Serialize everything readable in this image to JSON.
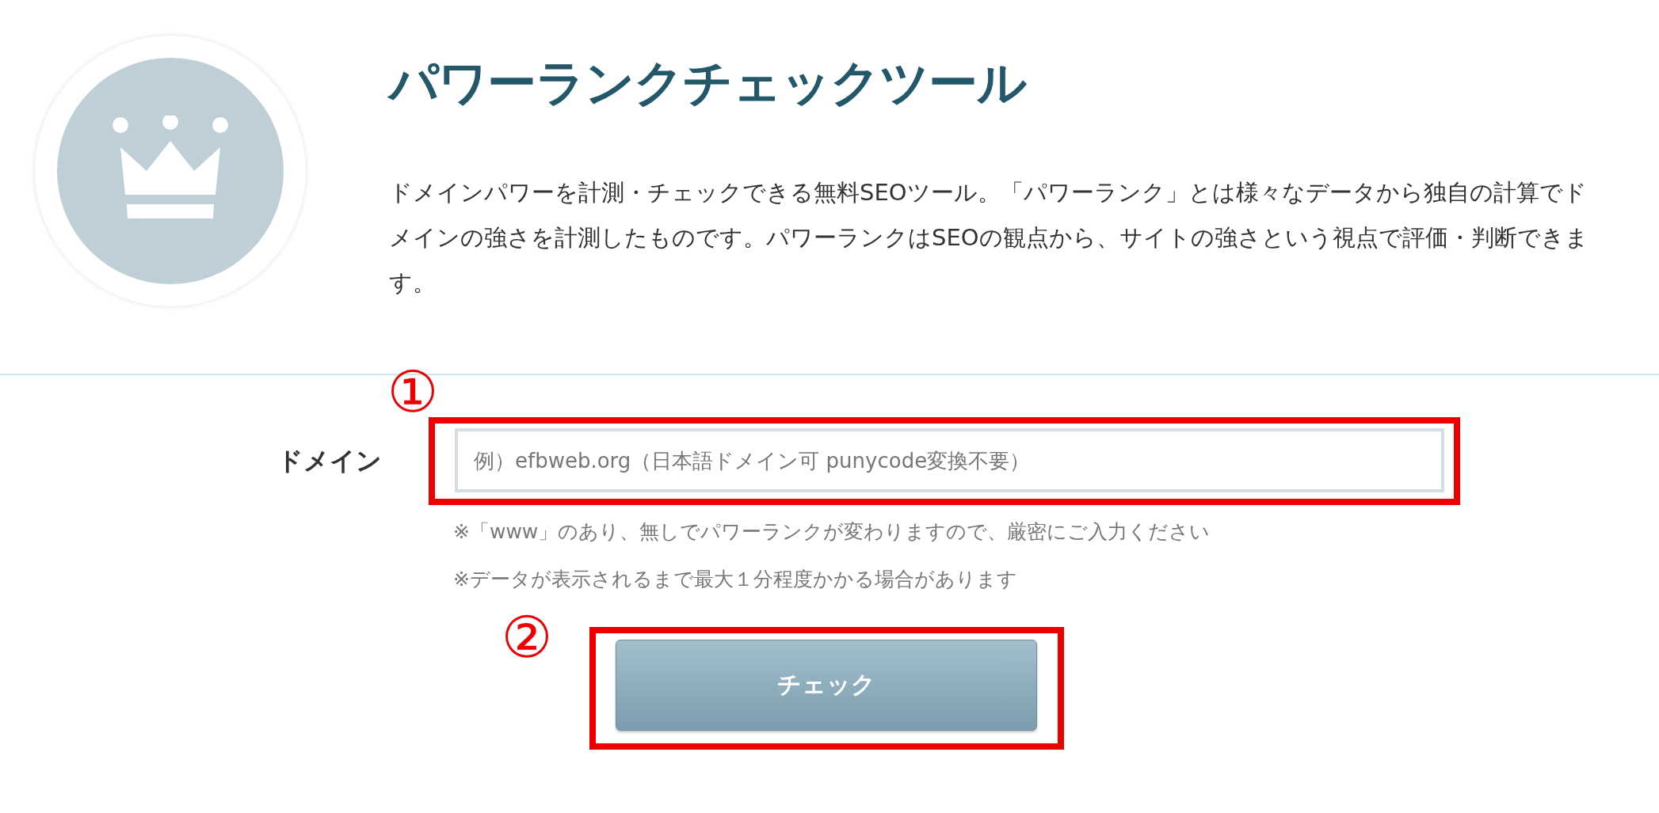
{
  "title": "パワーランクチェックツール",
  "description": "ドメインパワーを計測・チェックできる無料SEOツール。「パワーランク」とは様々なデータから独自の計算でドメインの強さを計測したものです。パワーランクはSEOの観点から、サイトの強さという視点で評価・判断できます。",
  "form": {
    "label": "ドメイン",
    "placeholder": "例）efbweb.org（日本語ドメイン可 punycode変換不要）",
    "notes": [
      "※「www」のあり、無しでパワーランクが変わりますので、厳密にご入力ください",
      "※データが表示されるまで最大１分程度かかる場合があります"
    ],
    "button": "チェック"
  },
  "annotations": [
    "①",
    "②"
  ]
}
